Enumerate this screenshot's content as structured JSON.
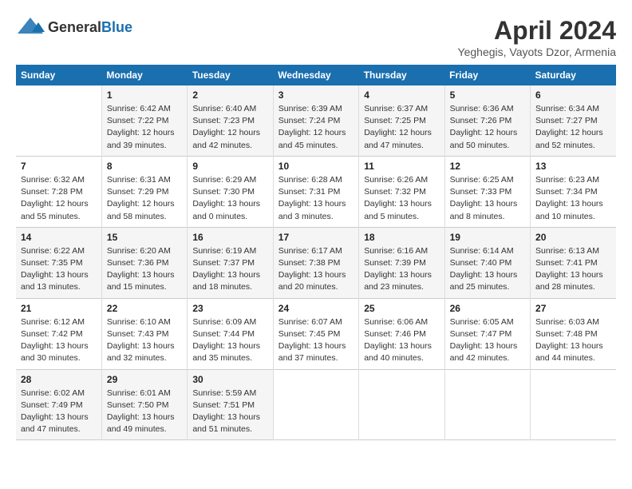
{
  "header": {
    "logo_general": "General",
    "logo_blue": "Blue",
    "month_title": "April 2024",
    "location": "Yeghegis, Vayots Dzor, Armenia"
  },
  "weekdays": [
    "Sunday",
    "Monday",
    "Tuesday",
    "Wednesday",
    "Thursday",
    "Friday",
    "Saturday"
  ],
  "weeks": [
    [
      {
        "day": "",
        "text": ""
      },
      {
        "day": "1",
        "text": "Sunrise: 6:42 AM\nSunset: 7:22 PM\nDaylight: 12 hours\nand 39 minutes."
      },
      {
        "day": "2",
        "text": "Sunrise: 6:40 AM\nSunset: 7:23 PM\nDaylight: 12 hours\nand 42 minutes."
      },
      {
        "day": "3",
        "text": "Sunrise: 6:39 AM\nSunset: 7:24 PM\nDaylight: 12 hours\nand 45 minutes."
      },
      {
        "day": "4",
        "text": "Sunrise: 6:37 AM\nSunset: 7:25 PM\nDaylight: 12 hours\nand 47 minutes."
      },
      {
        "day": "5",
        "text": "Sunrise: 6:36 AM\nSunset: 7:26 PM\nDaylight: 12 hours\nand 50 minutes."
      },
      {
        "day": "6",
        "text": "Sunrise: 6:34 AM\nSunset: 7:27 PM\nDaylight: 12 hours\nand 52 minutes."
      }
    ],
    [
      {
        "day": "7",
        "text": "Sunrise: 6:32 AM\nSunset: 7:28 PM\nDaylight: 12 hours\nand 55 minutes."
      },
      {
        "day": "8",
        "text": "Sunrise: 6:31 AM\nSunset: 7:29 PM\nDaylight: 12 hours\nand 58 minutes."
      },
      {
        "day": "9",
        "text": "Sunrise: 6:29 AM\nSunset: 7:30 PM\nDaylight: 13 hours\nand 0 minutes."
      },
      {
        "day": "10",
        "text": "Sunrise: 6:28 AM\nSunset: 7:31 PM\nDaylight: 13 hours\nand 3 minutes."
      },
      {
        "day": "11",
        "text": "Sunrise: 6:26 AM\nSunset: 7:32 PM\nDaylight: 13 hours\nand 5 minutes."
      },
      {
        "day": "12",
        "text": "Sunrise: 6:25 AM\nSunset: 7:33 PM\nDaylight: 13 hours\nand 8 minutes."
      },
      {
        "day": "13",
        "text": "Sunrise: 6:23 AM\nSunset: 7:34 PM\nDaylight: 13 hours\nand 10 minutes."
      }
    ],
    [
      {
        "day": "14",
        "text": "Sunrise: 6:22 AM\nSunset: 7:35 PM\nDaylight: 13 hours\nand 13 minutes."
      },
      {
        "day": "15",
        "text": "Sunrise: 6:20 AM\nSunset: 7:36 PM\nDaylight: 13 hours\nand 15 minutes."
      },
      {
        "day": "16",
        "text": "Sunrise: 6:19 AM\nSunset: 7:37 PM\nDaylight: 13 hours\nand 18 minutes."
      },
      {
        "day": "17",
        "text": "Sunrise: 6:17 AM\nSunset: 7:38 PM\nDaylight: 13 hours\nand 20 minutes."
      },
      {
        "day": "18",
        "text": "Sunrise: 6:16 AM\nSunset: 7:39 PM\nDaylight: 13 hours\nand 23 minutes."
      },
      {
        "day": "19",
        "text": "Sunrise: 6:14 AM\nSunset: 7:40 PM\nDaylight: 13 hours\nand 25 minutes."
      },
      {
        "day": "20",
        "text": "Sunrise: 6:13 AM\nSunset: 7:41 PM\nDaylight: 13 hours\nand 28 minutes."
      }
    ],
    [
      {
        "day": "21",
        "text": "Sunrise: 6:12 AM\nSunset: 7:42 PM\nDaylight: 13 hours\nand 30 minutes."
      },
      {
        "day": "22",
        "text": "Sunrise: 6:10 AM\nSunset: 7:43 PM\nDaylight: 13 hours\nand 32 minutes."
      },
      {
        "day": "23",
        "text": "Sunrise: 6:09 AM\nSunset: 7:44 PM\nDaylight: 13 hours\nand 35 minutes."
      },
      {
        "day": "24",
        "text": "Sunrise: 6:07 AM\nSunset: 7:45 PM\nDaylight: 13 hours\nand 37 minutes."
      },
      {
        "day": "25",
        "text": "Sunrise: 6:06 AM\nSunset: 7:46 PM\nDaylight: 13 hours\nand 40 minutes."
      },
      {
        "day": "26",
        "text": "Sunrise: 6:05 AM\nSunset: 7:47 PM\nDaylight: 13 hours\nand 42 minutes."
      },
      {
        "day": "27",
        "text": "Sunrise: 6:03 AM\nSunset: 7:48 PM\nDaylight: 13 hours\nand 44 minutes."
      }
    ],
    [
      {
        "day": "28",
        "text": "Sunrise: 6:02 AM\nSunset: 7:49 PM\nDaylight: 13 hours\nand 47 minutes."
      },
      {
        "day": "29",
        "text": "Sunrise: 6:01 AM\nSunset: 7:50 PM\nDaylight: 13 hours\nand 49 minutes."
      },
      {
        "day": "30",
        "text": "Sunrise: 5:59 AM\nSunset: 7:51 PM\nDaylight: 13 hours\nand 51 minutes."
      },
      {
        "day": "",
        "text": ""
      },
      {
        "day": "",
        "text": ""
      },
      {
        "day": "",
        "text": ""
      },
      {
        "day": "",
        "text": ""
      }
    ]
  ]
}
